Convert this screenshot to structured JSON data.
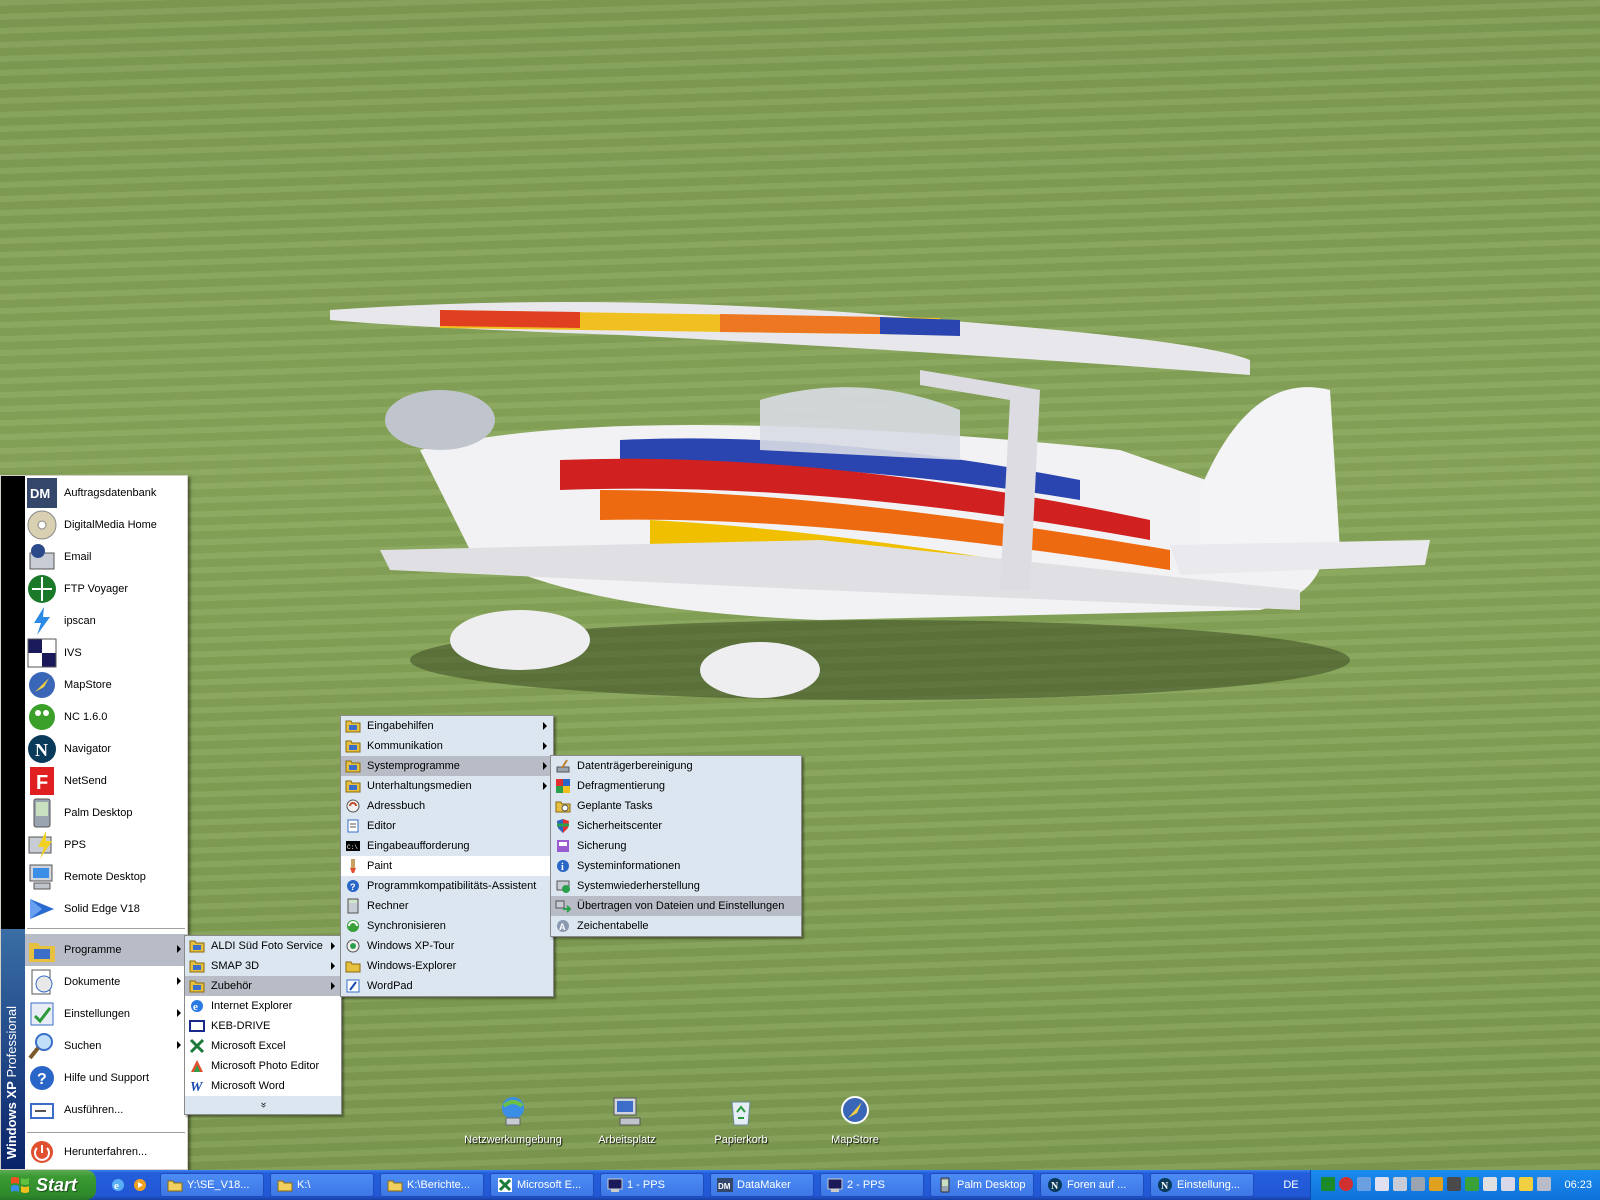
{
  "colors": {
    "taskbar": "#245edb",
    "start": "#3c9a33",
    "menu_bg": "#dbe6f0",
    "highlight": "#b8bcc6"
  },
  "desktop_icons": [
    {
      "label": "Netzwerkumgebung",
      "icon": "network-places-icon"
    },
    {
      "label": "Arbeitsplatz",
      "icon": "my-computer-icon"
    },
    {
      "label": "Papierkorb",
      "icon": "recycle-bin-icon"
    },
    {
      "label": "MapStore",
      "icon": "mapstore-icon"
    }
  ],
  "start_menu": {
    "band_title": "Windows",
    "band_xp": "XP",
    "band_edition": "Professional",
    "pinned": [
      {
        "label": "Auftragsdatenbank",
        "icon": "dm-icon"
      },
      {
        "label": "DigitalMedia Home",
        "icon": "cd-icon"
      },
      {
        "label": "Email",
        "icon": "email-icon"
      },
      {
        "label": "FTP Voyager",
        "icon": "ftp-icon"
      },
      {
        "label": "ipscan",
        "icon": "lightning-icon"
      },
      {
        "label": "IVS",
        "icon": "ivs-icon"
      },
      {
        "label": "MapStore",
        "icon": "compass-icon"
      },
      {
        "label": "NC 1.6.0",
        "icon": "nc-icon"
      },
      {
        "label": "Navigator",
        "icon": "navigator-icon"
      },
      {
        "label": "NetSend",
        "icon": "netsend-icon"
      },
      {
        "label": "Palm Desktop",
        "icon": "palm-icon"
      },
      {
        "label": "PPS",
        "icon": "pps-icon"
      },
      {
        "label": "Remote Desktop",
        "icon": "remote-desktop-icon"
      },
      {
        "label": "Solid Edge V18",
        "icon": "solid-edge-icon"
      }
    ],
    "system": [
      {
        "label": "Programme",
        "icon": "programs-icon",
        "submenu": true
      },
      {
        "label": "Dokumente",
        "icon": "documents-icon",
        "submenu": true
      },
      {
        "label": "Einstellungen",
        "icon": "settings-icon",
        "submenu": true
      },
      {
        "label": "Suchen",
        "icon": "search-icon",
        "submenu": true
      },
      {
        "label": "Hilfe und Support",
        "icon": "help-icon",
        "submenu": false
      },
      {
        "label": "Ausführen...",
        "icon": "run-icon",
        "submenu": false
      }
    ],
    "shutdown": "Herunterfahren..."
  },
  "programme_menu": [
    {
      "label": "ALDI Süd Foto Service",
      "icon": "folder-icon",
      "submenu": true
    },
    {
      "label": "SMAP 3D",
      "icon": "folder-icon",
      "submenu": true
    },
    {
      "label": "Zubehör",
      "icon": "folder-icon",
      "submenu": true
    },
    {
      "label": "Internet Explorer",
      "icon": "ie-icon",
      "submenu": false
    },
    {
      "label": "KEB-DRIVE",
      "icon": "window-icon",
      "submenu": false
    },
    {
      "label": "Microsoft Excel",
      "icon": "excel-icon",
      "submenu": false
    },
    {
      "label": "Microsoft Photo Editor",
      "icon": "photo-editor-icon",
      "submenu": false
    },
    {
      "label": "Microsoft Word",
      "icon": "word-icon",
      "submenu": false
    }
  ],
  "programme_more": "»",
  "zubehoer_menu": [
    {
      "label": "Eingabehilfen",
      "icon": "folder-icon",
      "submenu": true
    },
    {
      "label": "Kommunikation",
      "icon": "folder-icon",
      "submenu": true
    },
    {
      "label": "Systemprogramme",
      "icon": "folder-icon",
      "submenu": true
    },
    {
      "label": "Unterhaltungsmedien",
      "icon": "folder-icon",
      "submenu": true
    },
    {
      "label": "Adressbuch",
      "icon": "address-book-icon",
      "submenu": false
    },
    {
      "label": "Editor",
      "icon": "notepad-icon",
      "submenu": false
    },
    {
      "label": "Eingabeaufforderung",
      "icon": "cmd-icon",
      "submenu": false
    },
    {
      "label": "Paint",
      "icon": "paint-icon",
      "submenu": false
    },
    {
      "label": "Programmkompatibilitäts-Assistent",
      "icon": "help-icon",
      "submenu": false
    },
    {
      "label": "Rechner",
      "icon": "calculator-icon",
      "submenu": false
    },
    {
      "label": "Synchronisieren",
      "icon": "sync-icon",
      "submenu": false
    },
    {
      "label": "Windows XP-Tour",
      "icon": "tour-icon",
      "submenu": false
    },
    {
      "label": "Windows-Explorer",
      "icon": "explorer-icon",
      "submenu": false
    },
    {
      "label": "WordPad",
      "icon": "wordpad-icon",
      "submenu": false
    }
  ],
  "system_menu": [
    {
      "label": "Datenträgerbereinigung",
      "icon": "disk-cleanup-icon"
    },
    {
      "label": "Defragmentierung",
      "icon": "defrag-icon"
    },
    {
      "label": "Geplante Tasks",
      "icon": "tasks-icon"
    },
    {
      "label": "Sicherheitscenter",
      "icon": "shield-icon"
    },
    {
      "label": "Sicherung",
      "icon": "backup-icon"
    },
    {
      "label": "Systeminformationen",
      "icon": "info-icon"
    },
    {
      "label": "Systemwiederherstellung",
      "icon": "restore-icon"
    },
    {
      "label": "Übertragen von Dateien und Einstellungen",
      "icon": "transfer-icon"
    },
    {
      "label": "Zeichentabelle",
      "icon": "charmap-icon"
    }
  ],
  "taskbar": {
    "start_label": "Start",
    "buttons": [
      {
        "label": "Y:\\SE_V18...",
        "icon": "folder-icon"
      },
      {
        "label": "K:\\",
        "icon": "folder-icon"
      },
      {
        "label": "K:\\Berichte...",
        "icon": "folder-icon"
      },
      {
        "label": "Microsoft E...",
        "icon": "excel-icon"
      },
      {
        "label": "1 - PPS",
        "icon": "terminal-icon"
      },
      {
        "label": "DataMaker",
        "icon": "dm-icon"
      },
      {
        "label": "2 - PPS",
        "icon": "terminal-icon"
      },
      {
        "label": "Palm Desktop",
        "icon": "palm-icon"
      },
      {
        "label": "Foren auf ...",
        "icon": "navigator-icon"
      },
      {
        "label": "Einstellung...",
        "icon": "navigator-icon"
      }
    ],
    "language": "DE",
    "clock": "06:23"
  }
}
